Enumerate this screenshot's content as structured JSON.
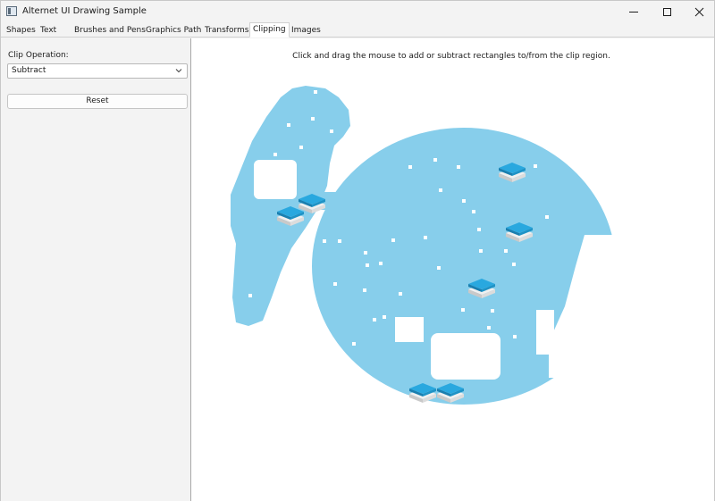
{
  "window": {
    "title": "Alternet UI Drawing Sample",
    "icon": "app-window-icon"
  },
  "tabs": [
    {
      "label": "Shapes",
      "active": false
    },
    {
      "label": "Text",
      "active": false
    },
    {
      "label": "Brushes and Pens",
      "active": false
    },
    {
      "label": "Graphics Path",
      "active": false
    },
    {
      "label": "Transforms",
      "active": false
    },
    {
      "label": "Clipping",
      "active": true
    },
    {
      "label": "Images",
      "active": false
    }
  ],
  "sidebar": {
    "clip_operation_label": "Clip Operation:",
    "clip_operation_value": "Subtract",
    "reset_label": "Reset"
  },
  "canvas": {
    "instructions": "Click and drag the mouse to add or subtract rectangles to/from the clip region.",
    "clip_fill_color": "#87ceeb",
    "snow_color": "#ffffff",
    "accent_color": "#29a8df"
  },
  "colors": {
    "window_bg": "#f3f3f3",
    "canvas_bg": "#ffffff",
    "border": "#c8c8c8"
  }
}
